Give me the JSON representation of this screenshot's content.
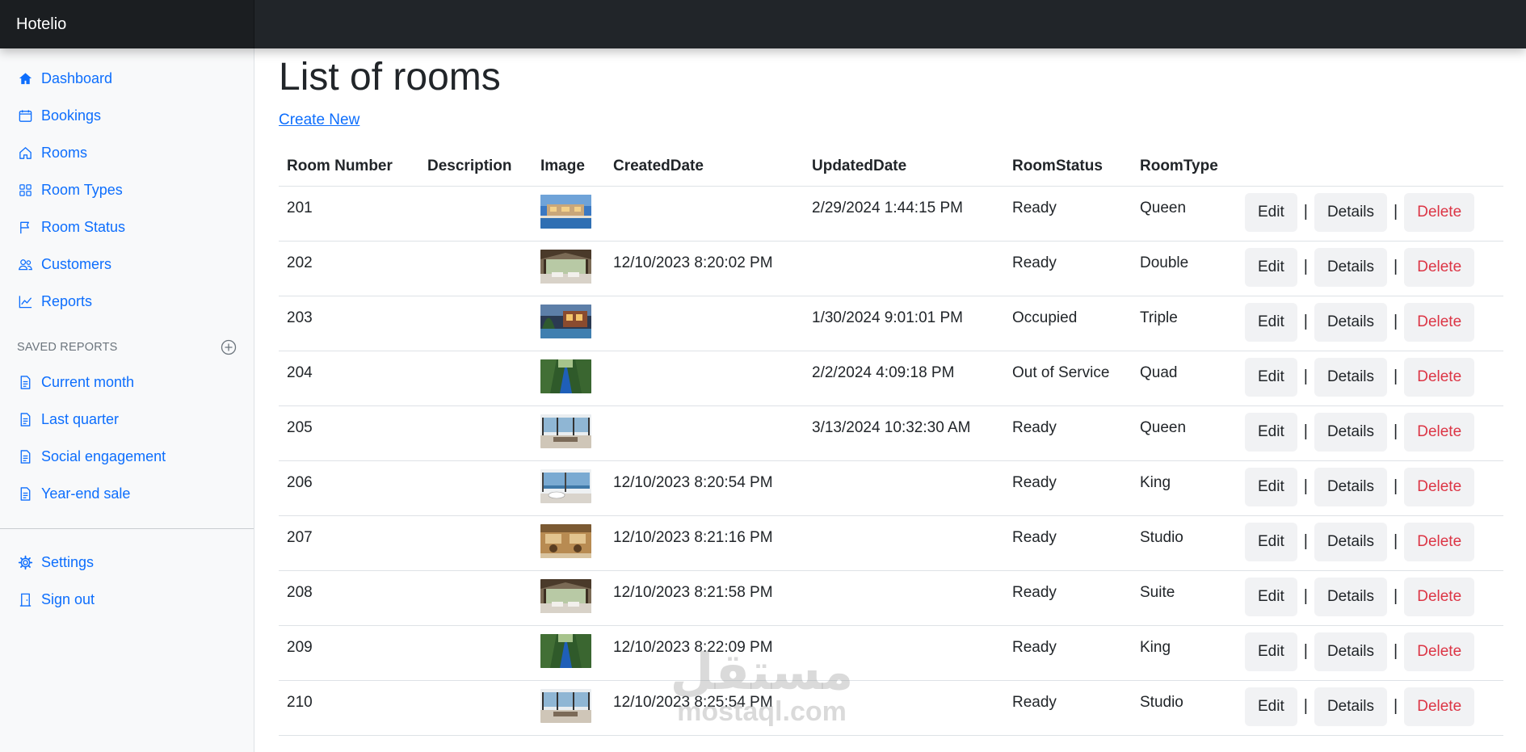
{
  "app": {
    "brand": "Hotelio"
  },
  "sidebar": {
    "items": [
      {
        "label": "Dashboard",
        "icon": "house-icon"
      },
      {
        "label": "Bookings",
        "icon": "calendar-icon"
      },
      {
        "label": "Rooms",
        "icon": "home-outline-icon"
      },
      {
        "label": "Room Types",
        "icon": "grid-icon"
      },
      {
        "label": "Room Status",
        "icon": "flag-icon"
      },
      {
        "label": "Customers",
        "icon": "users-icon"
      },
      {
        "label": "Reports",
        "icon": "line-chart-icon"
      }
    ],
    "saved_reports_heading": "SAVED REPORTS",
    "saved_reports": [
      {
        "label": "Current month",
        "icon": "file-icon"
      },
      {
        "label": "Last quarter",
        "icon": "file-icon"
      },
      {
        "label": "Social engagement",
        "icon": "file-icon"
      },
      {
        "label": "Year-end sale",
        "icon": "file-icon"
      }
    ],
    "footer": [
      {
        "label": "Settings",
        "icon": "gear-icon"
      },
      {
        "label": "Sign out",
        "icon": "door-icon"
      }
    ]
  },
  "main": {
    "title": "List of rooms",
    "create_link": "Create New",
    "columns": [
      "Room Number",
      "Description",
      "Image",
      "CreatedDate",
      "UpdatedDate",
      "RoomStatus",
      "RoomType",
      ""
    ],
    "actions": {
      "edit": "Edit",
      "details": "Details",
      "delete": "Delete",
      "separator": "|"
    },
    "rows": [
      {
        "number": "201",
        "description": "",
        "image": "resort-pool",
        "created": "",
        "updated": "2/29/2024 1:44:15 PM",
        "status": "Ready",
        "type": "Queen"
      },
      {
        "number": "202",
        "description": "",
        "image": "pavilion",
        "created": "12/10/2023 8:20:02 PM",
        "updated": "",
        "status": "Ready",
        "type": "Double"
      },
      {
        "number": "203",
        "description": "",
        "image": "villa-evening",
        "created": "",
        "updated": "1/30/2024 9:01:01 PM",
        "status": "Occupied",
        "type": "Triple"
      },
      {
        "number": "204",
        "description": "",
        "image": "jungle-pool",
        "created": "",
        "updated": "2/2/2024 4:09:18 PM",
        "status": "Out of Service",
        "type": "Quad"
      },
      {
        "number": "205",
        "description": "",
        "image": "lounge-view",
        "created": "",
        "updated": "3/13/2024 10:32:30 AM",
        "status": "Ready",
        "type": "Queen"
      },
      {
        "number": "206",
        "description": "",
        "image": "bath-sea",
        "created": "12/10/2023 8:20:54 PM",
        "updated": "",
        "status": "Ready",
        "type": "King"
      },
      {
        "number": "207",
        "description": "",
        "image": "dining",
        "created": "12/10/2023 8:21:16 PM",
        "updated": "",
        "status": "Ready",
        "type": "Studio"
      },
      {
        "number": "208",
        "description": "",
        "image": "pavilion",
        "created": "12/10/2023 8:21:58 PM",
        "updated": "",
        "status": "Ready",
        "type": "Suite"
      },
      {
        "number": "209",
        "description": "",
        "image": "jungle-pool",
        "created": "12/10/2023 8:22:09 PM",
        "updated": "",
        "status": "Ready",
        "type": "King"
      },
      {
        "number": "210",
        "description": "",
        "image": "lounge-view",
        "created": "12/10/2023 8:25:54 PM",
        "updated": "",
        "status": "Ready",
        "type": "Studio"
      }
    ]
  },
  "watermark": {
    "arabic": "مستقل",
    "latin": "mostaql.com"
  },
  "colors": {
    "accent": "#0d6efd",
    "danger": "#dc3545",
    "topbar": "#212529"
  }
}
